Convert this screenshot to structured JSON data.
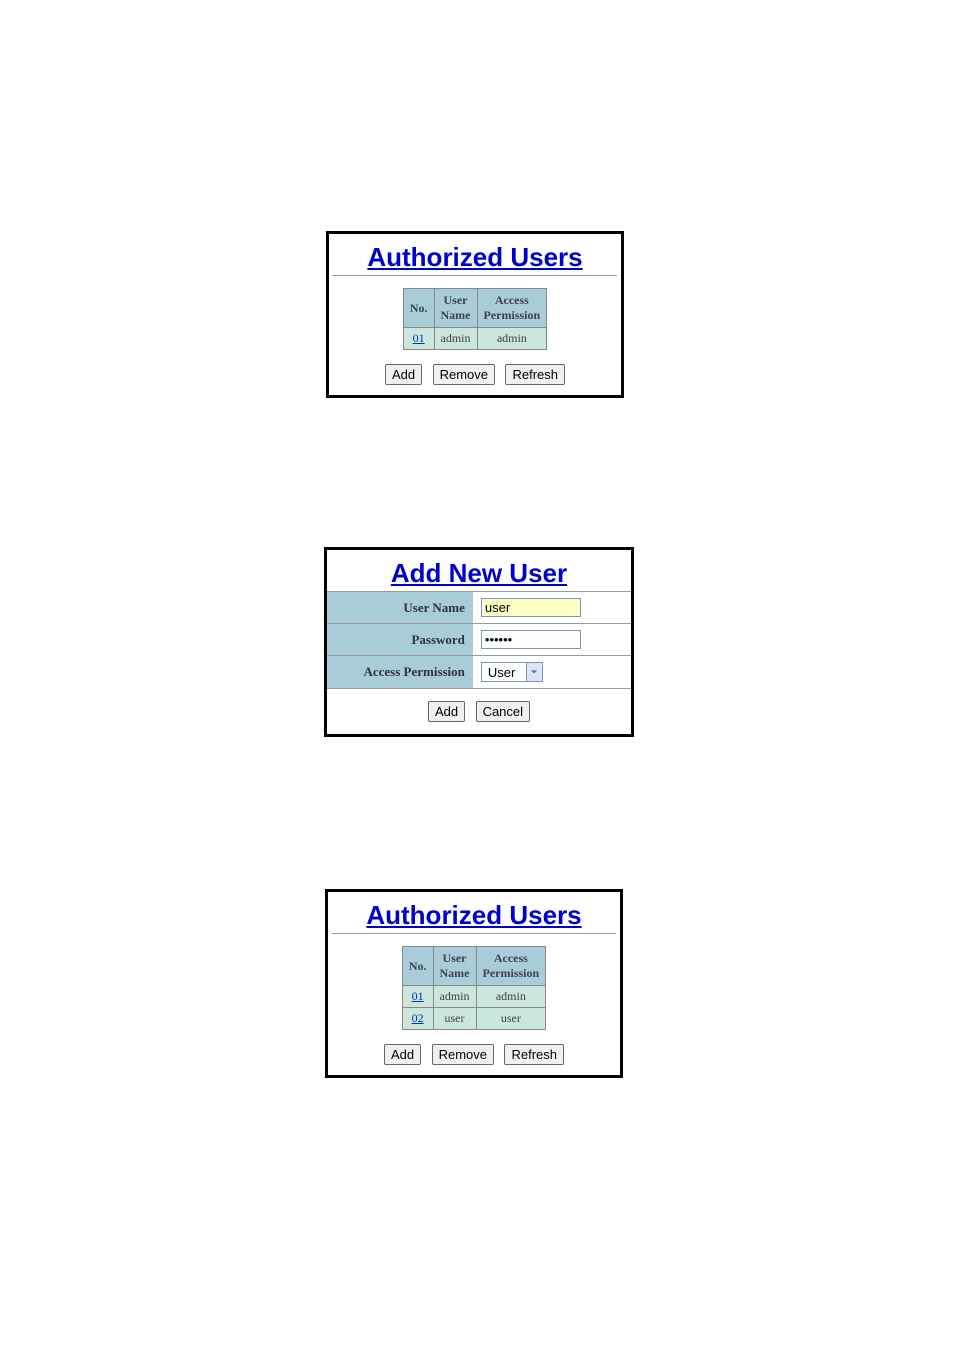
{
  "panel1": {
    "title": "Authorized Users",
    "headers": {
      "no": "No.",
      "username": "User\nName",
      "access": "Access\nPermission"
    },
    "rows": [
      {
        "no": "01",
        "username": "admin",
        "access": "admin"
      }
    ],
    "buttons": {
      "add": "Add",
      "remove": "Remove",
      "refresh": "Refresh"
    }
  },
  "panel2": {
    "title": "Add New User",
    "labels": {
      "username": "User Name",
      "password": "Password",
      "access": "Access Permission"
    },
    "values": {
      "username": "user",
      "password": "••••••",
      "access_selected": "User"
    },
    "buttons": {
      "add": "Add",
      "cancel": "Cancel"
    }
  },
  "panel3": {
    "title": "Authorized Users",
    "headers": {
      "no": "No.",
      "username": "User\nName",
      "access": "Access\nPermission"
    },
    "rows": [
      {
        "no": "01",
        "username": "admin",
        "access": "admin"
      },
      {
        "no": "02",
        "username": "user",
        "access": "user"
      }
    ],
    "buttons": {
      "add": "Add",
      "remove": "Remove",
      "refresh": "Refresh"
    }
  }
}
